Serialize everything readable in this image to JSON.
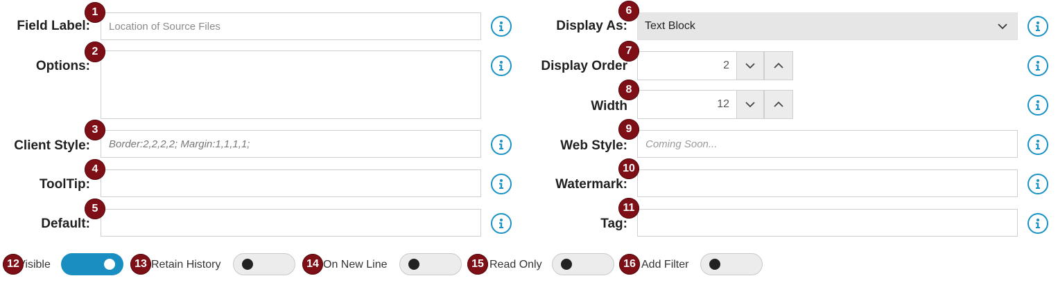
{
  "fields": {
    "field_label": {
      "label": "Field Label:",
      "placeholder": "Location of Source Files"
    },
    "options": {
      "label": "Options:",
      "value": ""
    },
    "client_style": {
      "label": "Client Style:",
      "placeholder": "Border:2,2,2,2; Margin:1,1,1,1;"
    },
    "tooltip": {
      "label": "ToolTip:",
      "value": ""
    },
    "default": {
      "label": "Default:",
      "value": ""
    },
    "display_as": {
      "label": "Display As:",
      "value": "Text Block"
    },
    "display_order": {
      "label": "Display Order",
      "value": "2"
    },
    "width": {
      "label": "Width",
      "value": "12"
    },
    "web_style": {
      "label": "Web Style:",
      "placeholder": "Coming Soon..."
    },
    "watermark": {
      "label": "Watermark:",
      "value": ""
    },
    "tag": {
      "label": "Tag:",
      "value": ""
    }
  },
  "toggles": [
    {
      "label": "Visible",
      "on": true
    },
    {
      "label": "Retain History",
      "on": false
    },
    {
      "label": "On New Line",
      "on": false
    },
    {
      "label": "Read Only",
      "on": false
    },
    {
      "label": "Add Filter",
      "on": false
    }
  ],
  "badges": [
    "1",
    "2",
    "3",
    "4",
    "5",
    "6",
    "7",
    "8",
    "9",
    "10",
    "11",
    "12",
    "13",
    "14",
    "15",
    "16"
  ],
  "colors": {
    "accent": "#1891c4",
    "badge": "#7f0f16",
    "toggle_on": "#1a8ec0"
  },
  "icons": {
    "info": "info-circle-icon",
    "dropdown": "chevron-down-icon",
    "increment": "chevron-up-icon",
    "decrement": "chevron-down-icon"
  }
}
